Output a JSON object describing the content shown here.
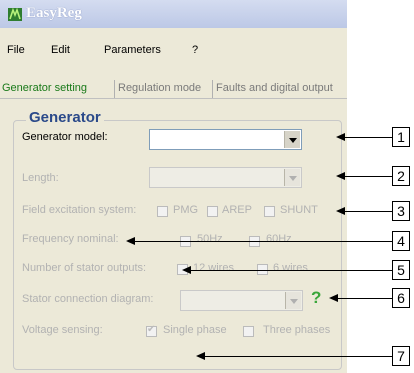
{
  "window": {
    "title": "EasyReg"
  },
  "menu": [
    "File",
    "Edit",
    "Parameters",
    "?"
  ],
  "tabs": [
    "Generator setting",
    "Regulation mode",
    "Faults and digital output"
  ],
  "group": {
    "title": "Generator",
    "generator_model_label": "Generator model:",
    "generator_model_value": "",
    "length_label": "Length:",
    "field_excitation_label": "Field excitation system:",
    "excitation_options": [
      "PMG",
      "AREP",
      "SHUNT"
    ],
    "frequency_label": "Frequency nominal:",
    "frequency_options": [
      "50Hz",
      "60Hz"
    ],
    "stator_outputs_label": "Number of stator outputs:",
    "stator_outputs_options": [
      "12 wires",
      "6 wires"
    ],
    "stator_diagram_label": "Stator connection diagram:",
    "help_symbol": "?",
    "voltage_sensing_label": "Voltage sensing:",
    "voltage_options": [
      "Single phase",
      "Three phases"
    ],
    "voltage_single_checked": true
  },
  "callouts": [
    "1",
    "2",
    "3",
    "4",
    "5",
    "6",
    "7"
  ],
  "icons": {
    "app": "easyreg-app-icon",
    "dropdown": "chevron-down-icon",
    "help": "question-mark-icon"
  },
  "colors": {
    "active_tab": "#1a7a1a",
    "group_title": "#2b4a8a",
    "help_icon": "#3aa63a",
    "disabled_text": "#b2b2b2"
  }
}
